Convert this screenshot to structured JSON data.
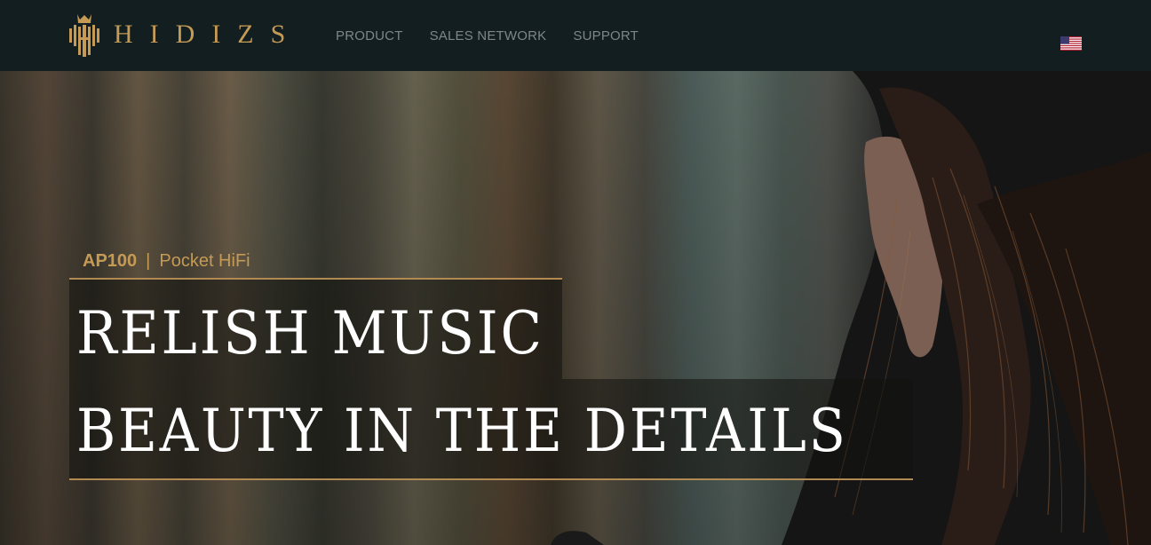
{
  "brand": {
    "name": "HIDIZS",
    "logo_icon": "crown-equalizer-icon",
    "color": "#c49a55"
  },
  "nav": {
    "items": [
      "PRODUCT",
      "SALES NETWORK",
      "SUPPORT"
    ]
  },
  "language": {
    "icon": "us-flag-icon"
  },
  "hero": {
    "model": "AP100",
    "separator": "|",
    "category": "Pocket HiFi",
    "headline_1": "RELISH MUSIC",
    "headline_2": "BEAUTY IN THE DETAILS"
  }
}
